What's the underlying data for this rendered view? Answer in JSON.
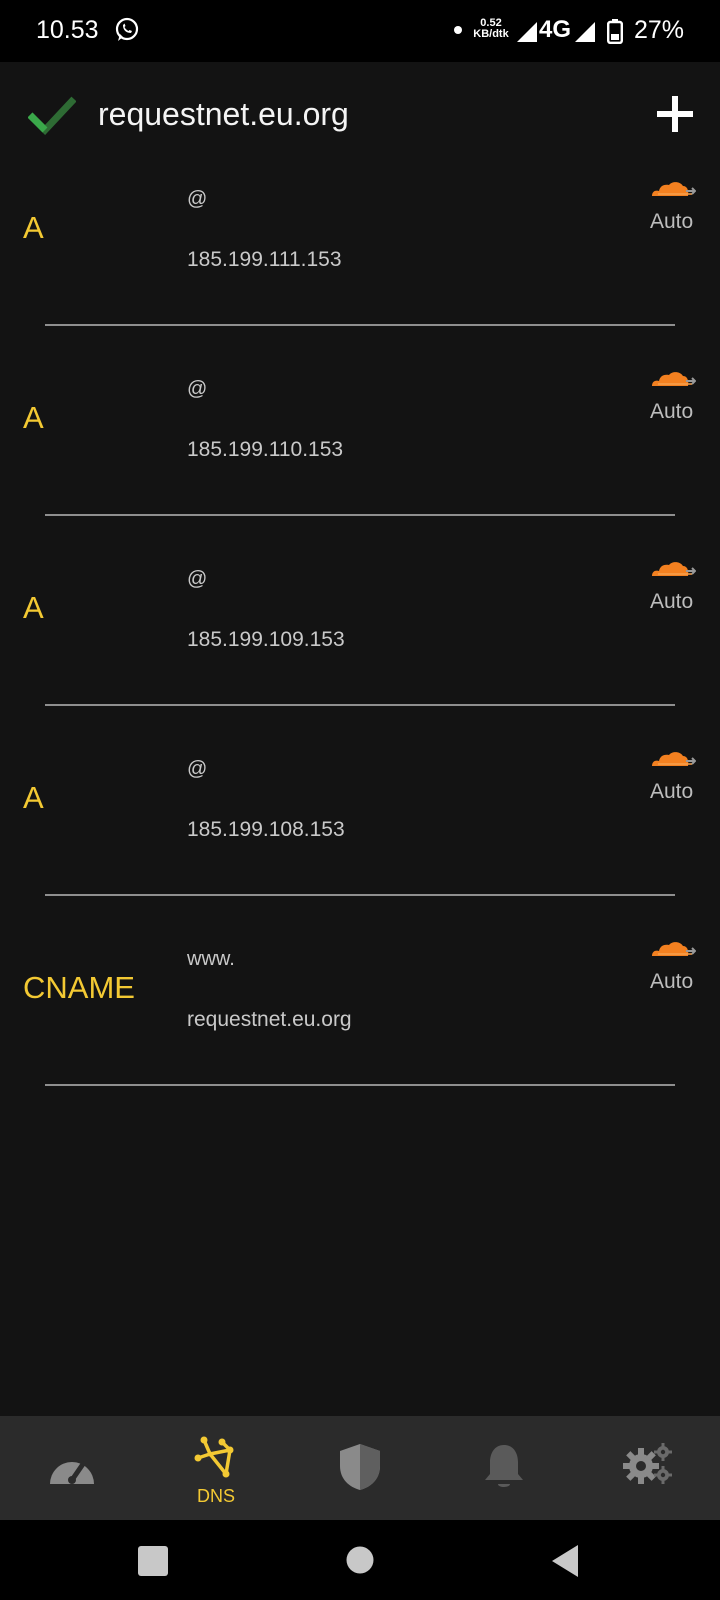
{
  "status_bar": {
    "time": "10.53",
    "speed_value": "0.52",
    "speed_unit": "KB/dtk",
    "network": "4G",
    "battery": "27%",
    "icons": [
      "whatsapp-icon",
      "notification-dot-icon",
      "signal-icon",
      "signal-icon",
      "battery-icon"
    ]
  },
  "header": {
    "title": "requestnet.eu.org",
    "status_icon": "check-icon",
    "add_icon": "plus-icon"
  },
  "records": [
    {
      "type": "A",
      "name": "@",
      "content": "185.199.111.153",
      "proxy": "Auto"
    },
    {
      "type": "A",
      "name": "@",
      "content": "185.199.110.153",
      "proxy": "Auto"
    },
    {
      "type": "A",
      "name": "@",
      "content": "185.199.109.153",
      "proxy": "Auto"
    },
    {
      "type": "A",
      "name": "@",
      "content": "185.199.108.153",
      "proxy": "Auto"
    },
    {
      "type": "CNAME",
      "name": "www.",
      "content": "requestnet.eu.org",
      "proxy": "Auto"
    }
  ],
  "bottom_nav": {
    "items": [
      {
        "icon": "speedometer-icon",
        "label": ""
      },
      {
        "icon": "dns-icon",
        "label": "DNS"
      },
      {
        "icon": "shield-icon",
        "label": ""
      },
      {
        "icon": "bell-icon",
        "label": ""
      },
      {
        "icon": "gears-icon",
        "label": ""
      }
    ],
    "active_index": 1
  },
  "system_nav": {
    "icons": [
      "recents-icon",
      "home-icon",
      "back-icon"
    ]
  },
  "colors": {
    "background": "#131313",
    "accent": "#f3c933",
    "cloud": "#f38020",
    "check": "#3aa84a",
    "nav_bar": "#2b2b2b"
  }
}
